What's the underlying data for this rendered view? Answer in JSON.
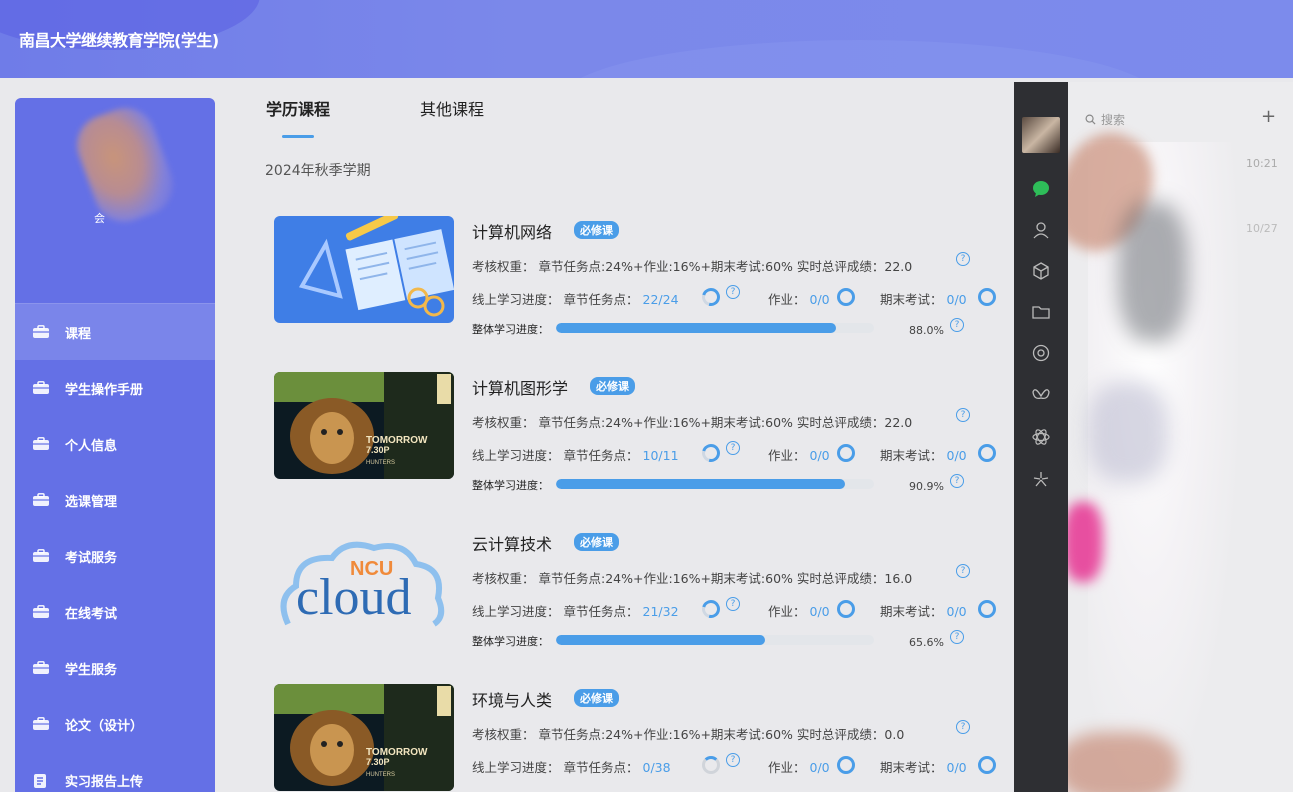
{
  "header": {
    "title": "南昌大学继续教育学院(学生)"
  },
  "profile": {
    "name": "会"
  },
  "sidebar": {
    "items": [
      {
        "label": "课程",
        "icon": "briefcase-icon",
        "active": true
      },
      {
        "label": "学生操作手册",
        "icon": "briefcase-icon"
      },
      {
        "label": "个人信息",
        "icon": "briefcase-icon"
      },
      {
        "label": "选课管理",
        "icon": "briefcase-icon"
      },
      {
        "label": "考试服务",
        "icon": "briefcase-icon"
      },
      {
        "label": "在线考试",
        "icon": "briefcase-icon"
      },
      {
        "label": "学生服务",
        "icon": "briefcase-icon"
      },
      {
        "label": "论文（设计）",
        "icon": "briefcase-icon"
      },
      {
        "label": "实习报告上传",
        "icon": "document-icon"
      }
    ]
  },
  "tabs": [
    {
      "label": "学历课程",
      "active": true
    },
    {
      "label": "其他课程"
    }
  ],
  "term": "2024年秋季学期",
  "labels": {
    "weight_prefix": "考核权重：",
    "online_prefix": "线上学习进度：",
    "chapter": "章节任务点：",
    "homework": "作业：",
    "final": "期末考试：",
    "overall": "整体学习进度："
  },
  "courses": [
    {
      "name": "计算机网络",
      "badge": "必修课",
      "weight": "章节任务点:24%+作业:16%+期末考试:60% 实时总评成绩：22.0",
      "chapter_progress": "22/24",
      "homework": "0/0",
      "final": "0/0",
      "overall_pct": "88.0%",
      "overall_value": 0.88,
      "thumb": "book-illustration"
    },
    {
      "name": "计算机图形学",
      "badge": "必修课",
      "weight": "章节任务点:24%+作业:16%+期末考试:60% 实时总评成绩：22.0",
      "chapter_progress": "10/11",
      "homework": "0/0",
      "final": "0/0",
      "overall_pct": "90.9%",
      "overall_value": 0.909,
      "thumb": "lion-poster",
      "poster_text": "TOMORROW",
      "poster_time": "7.30P",
      "poster_small": "HUNTERS"
    },
    {
      "name": "云计算技术",
      "badge": "必修课",
      "weight": "章节任务点:24%+作业:16%+期末考试:60% 实时总评成绩：16.0",
      "chapter_progress": "21/32",
      "homework": "0/0",
      "final": "0/0",
      "overall_pct": "65.6%",
      "overall_value": 0.656,
      "thumb": "ncu-cloud-logo",
      "logo_top": "NCU",
      "logo_main": "cloud"
    },
    {
      "name": "环境与人类",
      "badge": "必修课",
      "weight": "章节任务点:24%+作业:16%+期末考试:60% 实时总评成绩：0.0",
      "chapter_progress": "0/38",
      "homework": "0/0",
      "final": "0/0",
      "thumb": "lion-poster",
      "poster_text": "TOMORROW",
      "poster_time": "7.30P",
      "poster_small": "HUNTERS"
    }
  ],
  "chat": {
    "search_placeholder": "搜索",
    "plus": "+",
    "time1": "10:21",
    "time2": "10/27"
  },
  "colors": {
    "accent": "#4a9de8",
    "sidebar": "#6470e6",
    "header": "#7b88ea"
  }
}
